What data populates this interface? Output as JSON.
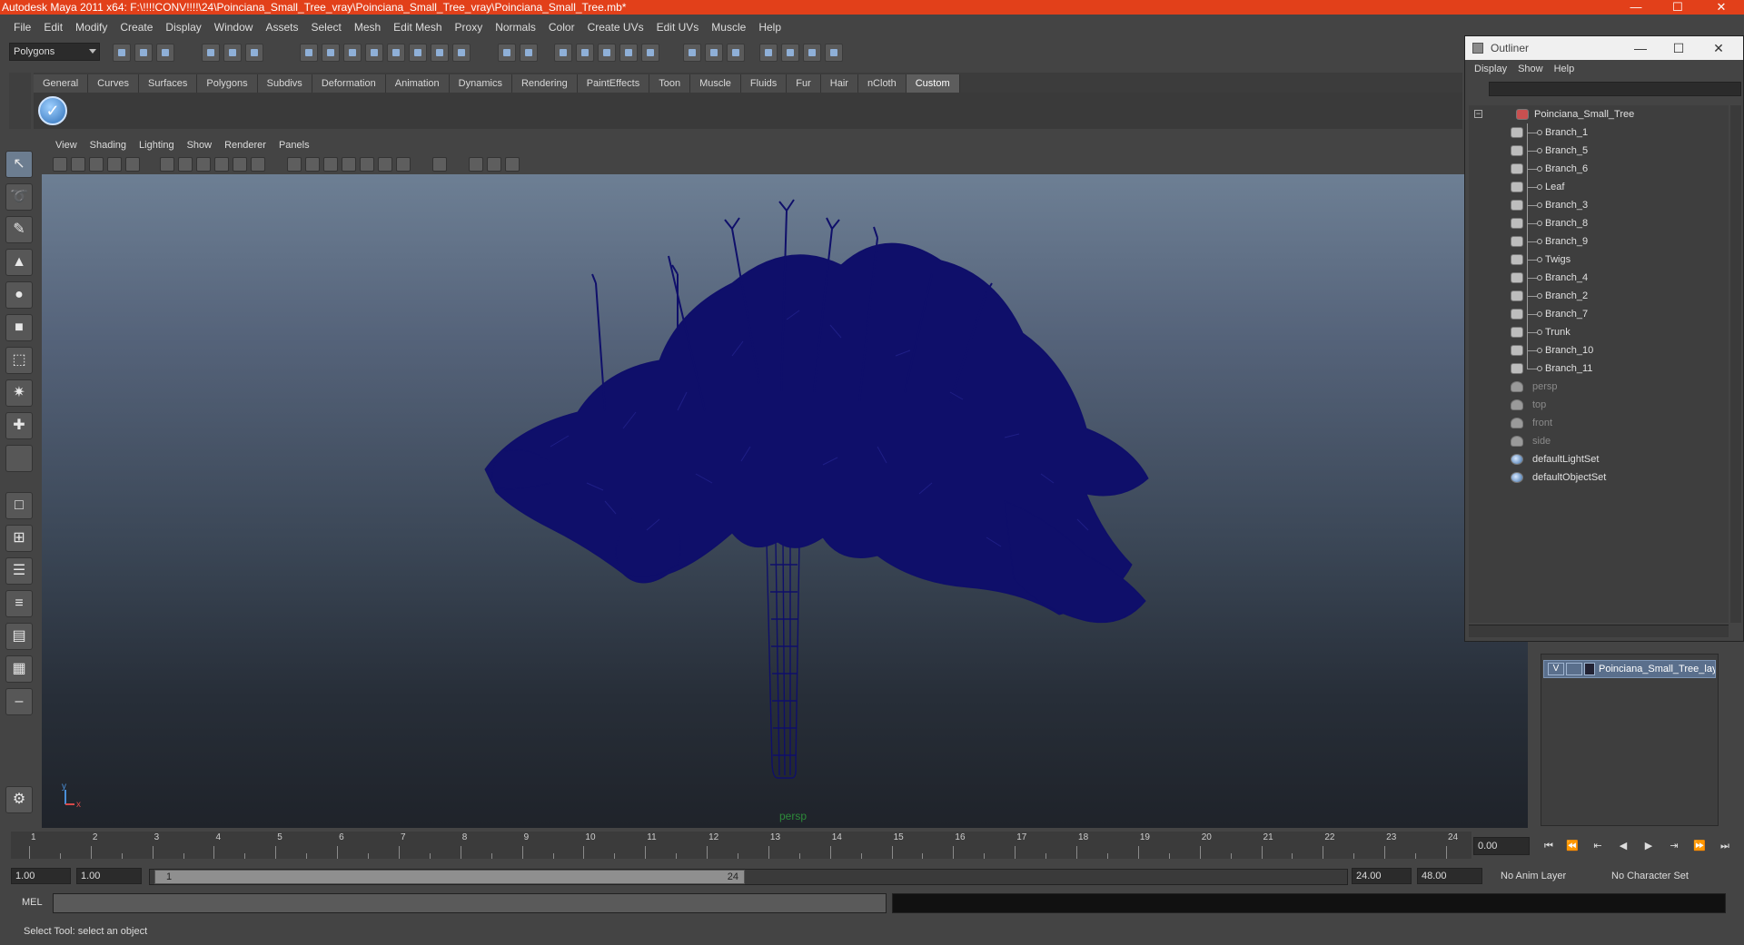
{
  "title_bar": {
    "title": "Autodesk Maya 2011 x64: F:\\!!!!CONV!!!!\\24\\Poinciana_Small_Tree_vray\\Poinciana_Small_Tree_vray\\Poinciana_Small_Tree.mb*",
    "minimize": "—",
    "maximize": "☐",
    "close": "✕"
  },
  "menubar": [
    "File",
    "Edit",
    "Modify",
    "Create",
    "Display",
    "Window",
    "Assets",
    "Select",
    "Mesh",
    "Edit Mesh",
    "Proxy",
    "Normals",
    "Color",
    "Create UVs",
    "Edit UVs",
    "Muscle",
    "Help"
  ],
  "statusline": {
    "menuset": "Polygons"
  },
  "shelf": {
    "tabs": [
      "General",
      "Curves",
      "Surfaces",
      "Polygons",
      "Subdivs",
      "Deformation",
      "Animation",
      "Dynamics",
      "Rendering",
      "PaintEffects",
      "Toon",
      "Muscle",
      "Fluids",
      "Fur",
      "Hair",
      "nCloth",
      "Custom"
    ],
    "active_tab": "Custom",
    "checkmark": "✓"
  },
  "panel_menu": [
    "View",
    "Shading",
    "Lighting",
    "Show",
    "Renderer",
    "Panels"
  ],
  "viewport": {
    "camera": "persp",
    "axis_y": "y",
    "axis_x": "x",
    "mesh_color": "#0f0f6a"
  },
  "outliner": {
    "title": "Outliner",
    "menu": [
      "Display",
      "Show",
      "Help"
    ],
    "root": "Poinciana_Small_Tree",
    "children": [
      "Branch_1",
      "Branch_5",
      "Branch_6",
      "Leaf",
      "Branch_3",
      "Branch_8",
      "Branch_9",
      "Twigs",
      "Branch_4",
      "Branch_2",
      "Branch_7",
      "Trunk",
      "Branch_10",
      "Branch_11"
    ],
    "cameras": [
      "persp",
      "top",
      "front",
      "side"
    ],
    "sets": [
      "defaultLightSet",
      "defaultObjectSet"
    ]
  },
  "layer_editor": {
    "visibility": "V",
    "layer_name": "Poinciana_Small_Tree_layer"
  },
  "timeline": {
    "ticks": [
      "1",
      "2",
      "3",
      "4",
      "5",
      "6",
      "7",
      "8",
      "9",
      "10",
      "11",
      "12",
      "13",
      "14",
      "15",
      "16",
      "17",
      "18",
      "19",
      "20",
      "21",
      "22",
      "23",
      "24"
    ],
    "current_time": "0.00"
  },
  "range": {
    "start": "1.00",
    "playback_start": "1.00",
    "handle_start": "1",
    "handle_end": "24",
    "playback_end": "24.00",
    "end": "48.00",
    "anim_layer": "No Anim Layer",
    "character_set": "No Character Set"
  },
  "command_line": {
    "label": "MEL"
  },
  "help_line": "Select Tool: select an object"
}
